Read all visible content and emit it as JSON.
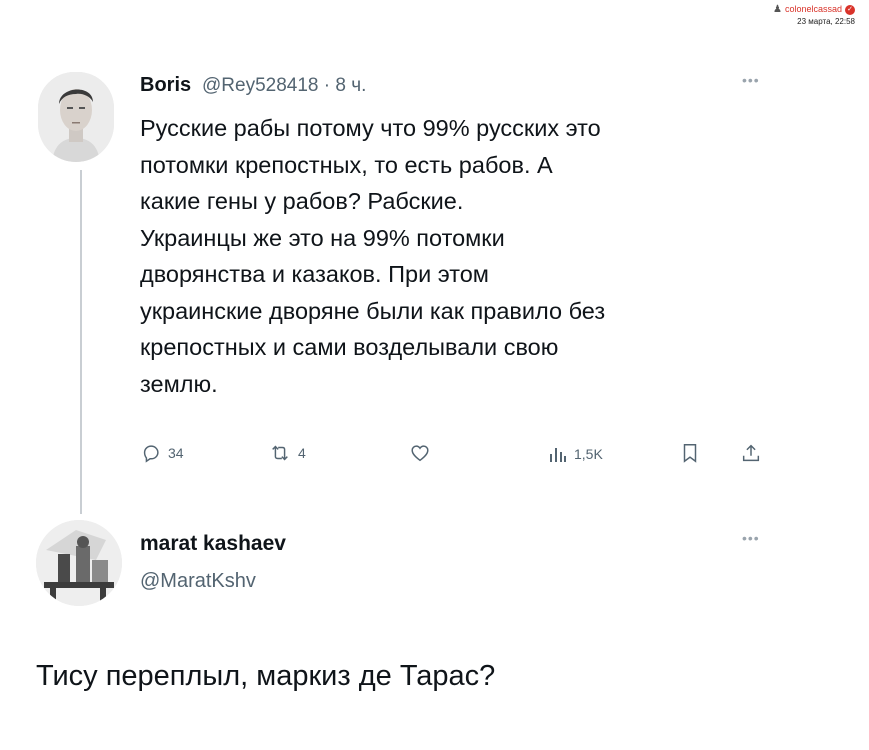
{
  "watermark": {
    "username": "colonelcassad",
    "date": "23 марта, 22:58"
  },
  "tweet": {
    "author_name": "Boris",
    "handle_time": "@Rey528418 · 8 ч.",
    "body_lines": [
      "Русские рабы потому что 99% русских это",
      "потомки крепостных, то есть рабов. А",
      "какие гены у рабов? Рабские.",
      "Украинцы же это на 99% потомки",
      "дворянства и казаков. При этом",
      "украинские дворяне были как правило без",
      "крепостных и сами возделывали свою",
      "землю."
    ],
    "stats": {
      "replies": "34",
      "reposts": "4",
      "views": "1,5K"
    }
  },
  "reply": {
    "author_name": "marat kashaev",
    "handle": "@MaratKshv",
    "text": "Тису переплыл, маркиз де Тарас?"
  },
  "icons": {
    "reply": "reply-icon",
    "repost": "repost-icon",
    "like": "heart-icon",
    "views": "views-icon",
    "bookmark": "bookmark-icon",
    "share": "share-icon",
    "more": "more-icon",
    "verified": "verified-icon"
  },
  "colors": {
    "text": "#0f1419",
    "muted": "#536471",
    "watermark": "#d9332a",
    "line": "#c9ced3"
  }
}
